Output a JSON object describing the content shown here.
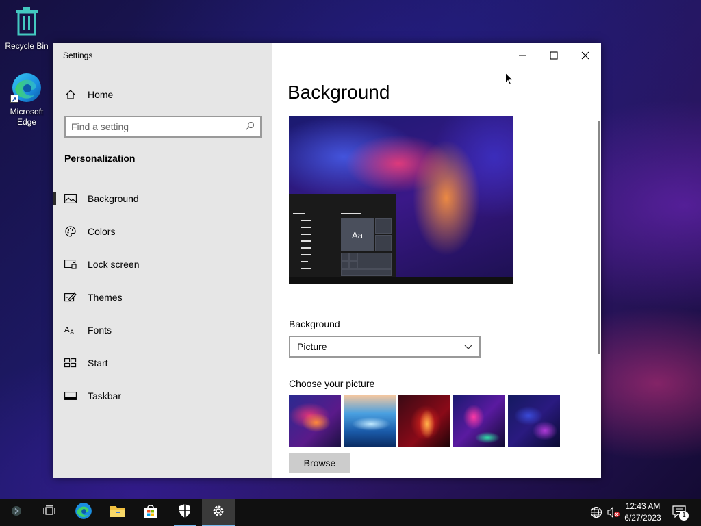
{
  "desktop": {
    "icons": [
      {
        "label": "Recycle Bin",
        "icon": "recycle-bin-icon"
      },
      {
        "label": "Microsoft Edge",
        "icon": "edge-icon"
      }
    ]
  },
  "window": {
    "title": "Settings",
    "controls": [
      "minimize-icon",
      "maximize-icon",
      "close-icon"
    ]
  },
  "sidebar": {
    "home_label": "Home",
    "search_placeholder": "Find a setting",
    "section_title": "Personalization",
    "items": [
      {
        "label": "Background",
        "icon": "picture-icon",
        "selected": true
      },
      {
        "label": "Colors",
        "icon": "palette-icon",
        "selected": false
      },
      {
        "label": "Lock screen",
        "icon": "lock-screen-icon",
        "selected": false
      },
      {
        "label": "Themes",
        "icon": "themes-icon",
        "selected": false
      },
      {
        "label": "Fonts",
        "icon": "fonts-icon",
        "selected": false
      },
      {
        "label": "Start",
        "icon": "start-icon",
        "selected": false
      },
      {
        "label": "Taskbar",
        "icon": "taskbar-icon",
        "selected": false
      }
    ]
  },
  "main": {
    "title": "Background",
    "preview_sample_text": "Aa",
    "background_label": "Background",
    "background_value": "Picture",
    "choose_picture_label": "Choose your picture",
    "browse_label": "Browse"
  },
  "taskbar": {
    "items": [
      "cortana-icon",
      "task-view-icon",
      "edge-icon",
      "file-explorer-icon",
      "store-icon",
      "security-icon",
      "settings-icon"
    ],
    "tray": [
      "network-icon",
      "volume-muted-icon"
    ],
    "time": "12:43 AM",
    "date": "6/27/2023",
    "notification_count": "1",
    "colors": {
      "accent": "#76b9ed",
      "background": "#101010"
    }
  }
}
